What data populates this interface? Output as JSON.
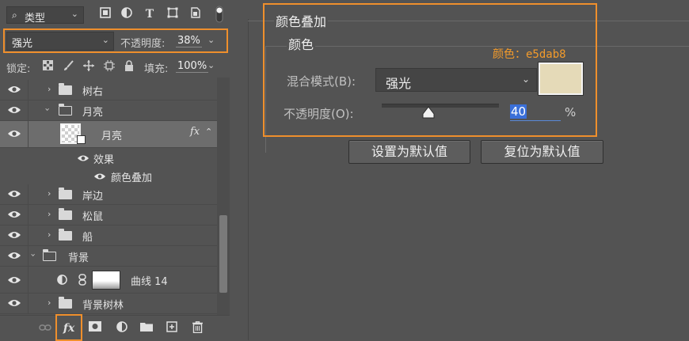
{
  "layers_panel": {
    "filter": {
      "kind_label": "类型"
    },
    "blend_mode": "强光",
    "opacity": {
      "label": "不透明度:",
      "value": "38%"
    },
    "lock": {
      "label": "锁定:"
    },
    "fill": {
      "label": "填充:",
      "value": "100%"
    },
    "layers": [
      {
        "name": "树右",
        "type": "group",
        "expanded": false
      },
      {
        "name": "月亮",
        "type": "group",
        "expanded": true
      },
      {
        "name": "月亮",
        "type": "layer",
        "selected": true,
        "fx_label": "fx"
      },
      {
        "name": "效果",
        "type": "effects"
      },
      {
        "name": "颜色叠加",
        "type": "effect"
      },
      {
        "name": "岸边",
        "type": "group",
        "expanded": false
      },
      {
        "name": "松鼠",
        "type": "group",
        "expanded": false
      },
      {
        "name": "船",
        "type": "group",
        "expanded": false
      },
      {
        "name": "背景",
        "type": "group",
        "expanded": true
      },
      {
        "name": "曲线 14",
        "type": "adjustment"
      },
      {
        "name": "背景树林",
        "type": "group",
        "expanded": false
      }
    ],
    "bottom_fx_label": "fx"
  },
  "color_overlay": {
    "title": "颜色叠加",
    "subtitle": "颜色",
    "annotation": "颜色：e5dab8",
    "blend_mode_label": "混合模式(B):",
    "blend_mode_value": "强光",
    "color": "#e5dab8",
    "opacity_label": "不透明度(O):",
    "opacity_value": "40",
    "opacity_percent": 40,
    "percent_sign": "%",
    "buttons": {
      "set_default": "设置为默认值",
      "reset_default": "复位为默认值"
    }
  },
  "colors": {
    "highlight": "#ef8f2c",
    "annotation": "#f39b2b",
    "selection": "#3a6fd8"
  }
}
